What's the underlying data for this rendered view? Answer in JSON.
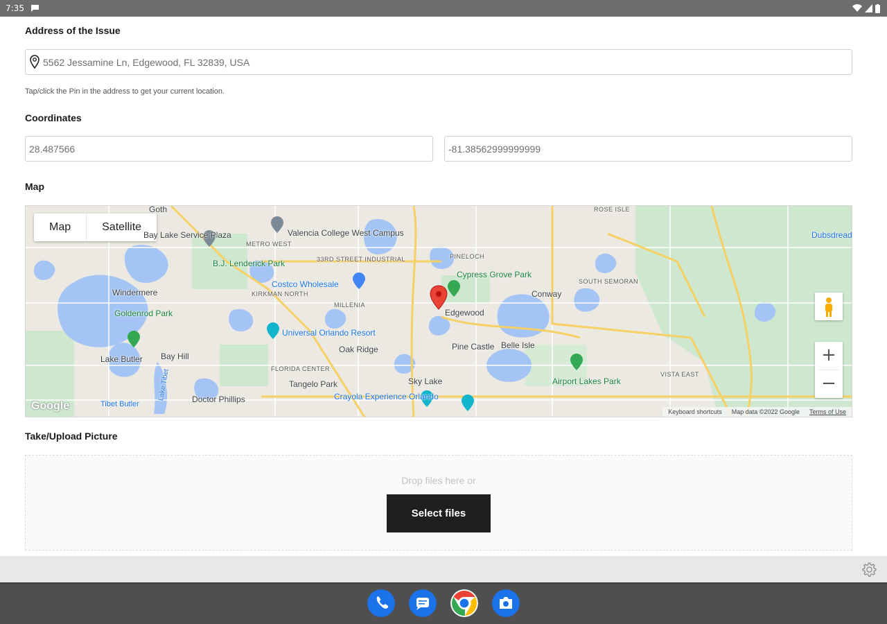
{
  "status": {
    "time": "7:35"
  },
  "form": {
    "address_label": "Address of the Issue",
    "address_value": "5562 Jessamine Ln, Edgewood, FL 32839, USA",
    "address_hint": "Tap/click the Pin in the address to get your current location.",
    "coordinates_label": "Coordinates",
    "latitude": "28.487566",
    "longitude": "-81.38562999999999",
    "map_label": "Map",
    "upload_label": "Take/Upload Picture",
    "drop_text": "Drop files here or",
    "select_files": "Select files"
  },
  "map": {
    "type_map": "Map",
    "type_satellite": "Satellite",
    "zoom_in": "+",
    "zoom_out": "−",
    "google": "Google",
    "attribution": {
      "shortcuts": "Keyboard shortcuts",
      "data": "Map data ©2022 Google",
      "terms": "Terms of Use"
    },
    "places": [
      {
        "name": "Windermere",
        "kind": "town"
      },
      {
        "name": "Edgewood",
        "kind": "town"
      },
      {
        "name": "Conway",
        "kind": "town"
      },
      {
        "name": "Pine Castle",
        "kind": "town"
      },
      {
        "name": "Belle Isle",
        "kind": "town"
      },
      {
        "name": "Oak Ridge",
        "kind": "town"
      },
      {
        "name": "Tangelo Park",
        "kind": "town"
      },
      {
        "name": "Sky Lake",
        "kind": "town"
      },
      {
        "name": "Doctor Phillips",
        "kind": "town"
      },
      {
        "name": "Lake Butler",
        "kind": "town"
      },
      {
        "name": "Bay Hill",
        "kind": "town"
      },
      {
        "name": "Goldenrod Park",
        "kind": "town"
      },
      {
        "name": "Bay Lake Service Plaza",
        "kind": "town"
      },
      {
        "name": "Valencia College West Campus",
        "kind": "poi"
      },
      {
        "name": "Costco Wholesale",
        "kind": "poi"
      },
      {
        "name": "Universal Orlando Resort",
        "kind": "poi"
      },
      {
        "name": "Crayola Experience Orlando",
        "kind": "poi"
      },
      {
        "name": "Cypress Grove Park",
        "kind": "park"
      },
      {
        "name": "Airport Lakes Park",
        "kind": "park"
      },
      {
        "name": "B.J. Lenderick Park",
        "kind": "park"
      },
      {
        "name": "Lake Tibet",
        "kind": "water"
      },
      {
        "name": "Tibet Butler",
        "kind": "water"
      },
      {
        "name": "Dubsdread",
        "kind": "town"
      },
      {
        "name": "Goth",
        "kind": "town"
      },
      {
        "name": "33RD STREET INDUSTRIAL",
        "kind": "district"
      },
      {
        "name": "METRO WEST",
        "kind": "district"
      },
      {
        "name": "MILLENIA",
        "kind": "district"
      },
      {
        "name": "SOUTH SEMORAN",
        "kind": "district"
      },
      {
        "name": "PINELOCH",
        "kind": "district"
      },
      {
        "name": "FLORIDA CENTER",
        "kind": "district"
      },
      {
        "name": "VISTA EAST",
        "kind": "district"
      },
      {
        "name": "KIRKMAN NORTH",
        "kind": "district"
      },
      {
        "name": "ROSE ISLE",
        "kind": "district"
      }
    ]
  }
}
